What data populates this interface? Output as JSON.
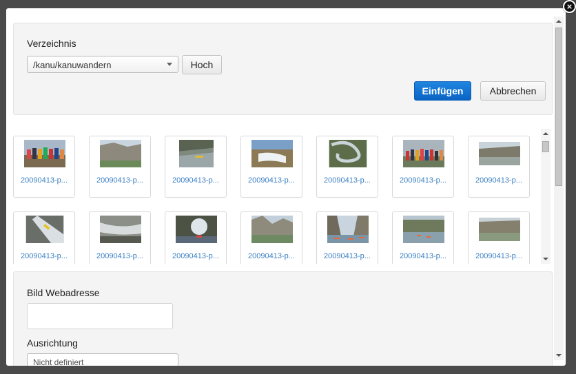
{
  "dialog": {
    "close_label": "×",
    "directory_label": "Verzeichnis",
    "directory_value": "/kanu/kanuwandern",
    "up_button": "Hoch",
    "insert_button": "Einfügen",
    "cancel_button": "Abbrechen",
    "image_url_label": "Bild Webadresse",
    "image_url_value": "",
    "alignment_label": "Ausrichtung",
    "alignment_value": "Nicht definiert"
  },
  "thumbnails": [
    {
      "name": "20090413-p...",
      "icon": "group-photo-image"
    },
    {
      "name": "20090413-p...",
      "icon": "cliff-river-image"
    },
    {
      "name": "20090413-p...",
      "icon": "kayak-river-image"
    },
    {
      "name": "20090413-p...",
      "icon": "rapids-image"
    },
    {
      "name": "20090413-p...",
      "icon": "river-bend-image"
    },
    {
      "name": "20090413-p...",
      "icon": "group-photo-image"
    },
    {
      "name": "20090413-p...",
      "icon": "gorge-image"
    },
    {
      "name": "20090413-p...",
      "icon": "kayak-waterfall-image"
    },
    {
      "name": "20090413-p...",
      "icon": "rocks-water-image"
    },
    {
      "name": "20090413-p...",
      "icon": "rock-arch-image"
    },
    {
      "name": "20090413-p...",
      "icon": "cliff-river-image"
    },
    {
      "name": "20090413-p...",
      "icon": "canoes-gorge-image"
    },
    {
      "name": "20090413-p...",
      "icon": "canoes-river-image"
    },
    {
      "name": "20090413-p...",
      "icon": "gorge-river-image"
    }
  ],
  "colors": {
    "accent": "#0a63c4",
    "link": "#3a7fc2"
  }
}
